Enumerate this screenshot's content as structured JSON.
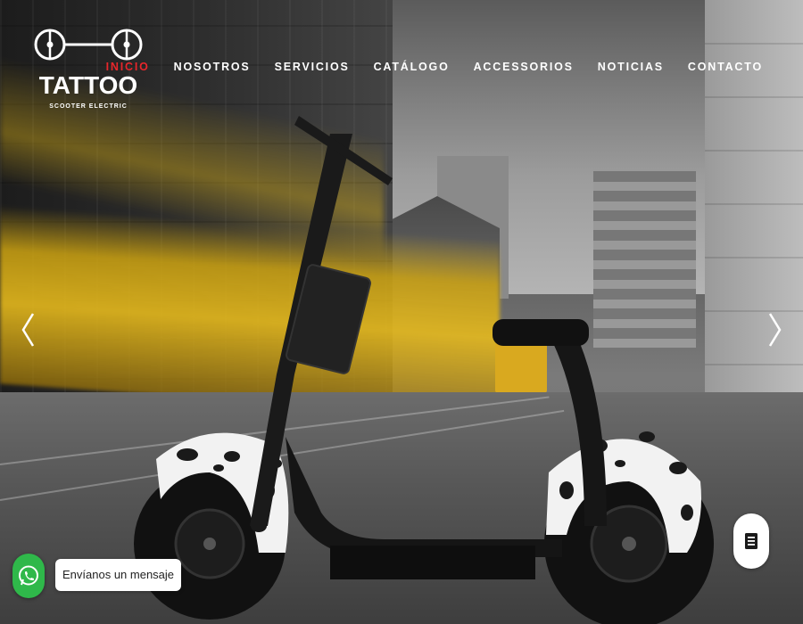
{
  "brand": {
    "name": "TATTOO",
    "tagline": "SCOOTER ELECTRIC"
  },
  "nav": {
    "items": [
      {
        "label": "INICIO",
        "active": true
      },
      {
        "label": "NOSOTROS",
        "active": false
      },
      {
        "label": "SERVICIOS",
        "active": false
      },
      {
        "label": "CATÁLOGO",
        "active": false
      },
      {
        "label": "ACCESSORIOS",
        "active": false
      },
      {
        "label": "NOTICIAS",
        "active": false
      },
      {
        "label": "CONTACTO",
        "active": false
      }
    ]
  },
  "slider": {
    "prev_icon": "chevron-left-icon",
    "next_icon": "chevron-right-icon"
  },
  "whatsapp": {
    "icon": "whatsapp-icon",
    "message": "Envíanos un mensaje"
  },
  "document_button": {
    "icon": "document-icon"
  },
  "colors": {
    "accent_active": "#e8262b",
    "whatsapp_green": "#2fb84a"
  }
}
